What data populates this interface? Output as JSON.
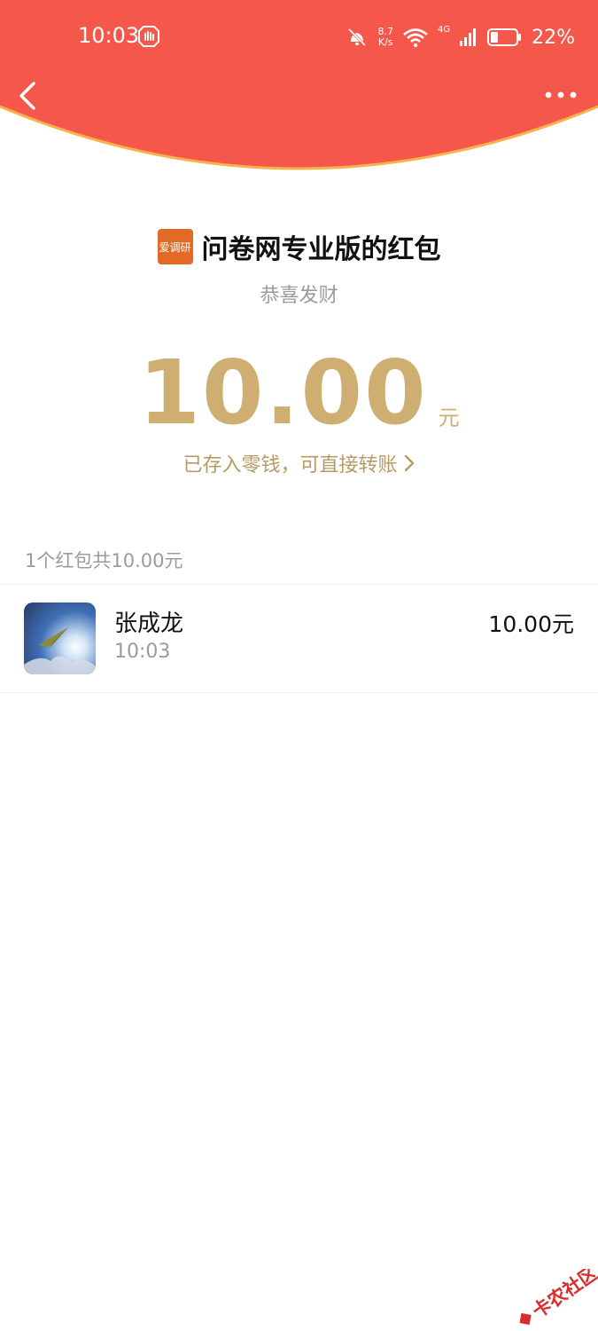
{
  "status_bar": {
    "time": "10:03",
    "speed_value": "8.7",
    "speed_unit": "K/s",
    "network": "4G",
    "battery": "22%"
  },
  "header": {
    "background_color": "#f5574a"
  },
  "packet": {
    "sender_logo_text": "爱调研",
    "title": "问卷网专业版的红包",
    "blessing": "恭喜发财",
    "amount": "10.00",
    "unit": "元",
    "deposit_note": "已存入零钱，可直接转账"
  },
  "summary": "1个红包共10.00元",
  "records": [
    {
      "name": "张成龙",
      "time": "10:03",
      "amount": "10.00元"
    }
  ],
  "watermark_text": "卡农社区",
  "accent_gold": "#cfae72"
}
